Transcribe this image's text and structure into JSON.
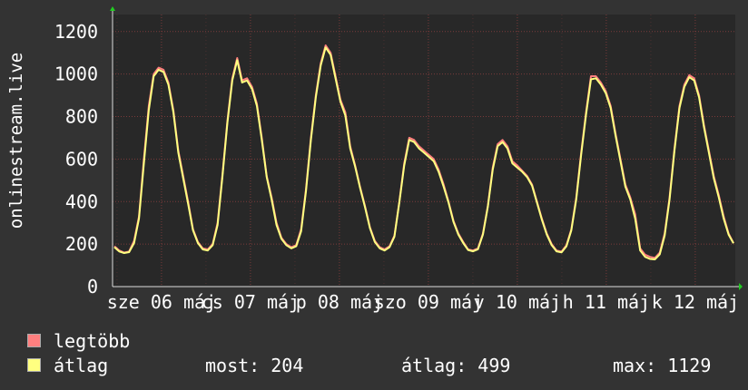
{
  "chart_data": {
    "type": "line",
    "ylabel": "onlinestream.live",
    "yticks": [
      0,
      200,
      400,
      600,
      800,
      1000,
      1200
    ],
    "ylim": [
      0,
      1280
    ],
    "x_tick_labels": [
      "sze 06 máj",
      "cs 07 máj",
      "p 08 máj",
      "szo 09 máj",
      "v 10 máj",
      "h 11 máj",
      "k 12 máj"
    ],
    "grid": true,
    "series": [
      {
        "name": "legtöbb",
        "color": "#ff7f7f",
        "values": [
          190,
          170,
          160,
          165,
          215,
          330,
          600,
          850,
          1000,
          1030,
          1020,
          960,
          830,
          640,
          520,
          400,
          270,
          210,
          180,
          175,
          200,
          300,
          530,
          780,
          980,
          1075,
          970,
          980,
          940,
          860,
          700,
          520,
          420,
          300,
          230,
          200,
          185,
          195,
          270,
          460,
          700,
          900,
          1050,
          1135,
          1100,
          990,
          880,
          820,
          660,
          570,
          470,
          380,
          280,
          215,
          185,
          175,
          190,
          240,
          400,
          580,
          700,
          690,
          660,
          640,
          620,
          600,
          550,
          480,
          400,
          310,
          250,
          210,
          175,
          170,
          180,
          250,
          380,
          560,
          670,
          690,
          660,
          590,
          570,
          545,
          520,
          480,
          400,
          320,
          250,
          200,
          170,
          165,
          195,
          270,
          420,
          630,
          820,
          990,
          990,
          960,
          920,
          850,
          720,
          600,
          480,
          420,
          340,
          180,
          150,
          140,
          135,
          160,
          250,
          420,
          650,
          850,
          950,
          995,
          980,
          900,
          760,
          640,
          520,
          430,
          330,
          250,
          205
        ]
      },
      {
        "name": "átlag",
        "color": "#ffff80",
        "values": [
          185,
          165,
          158,
          162,
          205,
          320,
          580,
          830,
          990,
          1020,
          1010,
          950,
          820,
          630,
          510,
          390,
          265,
          205,
          175,
          170,
          195,
          290,
          520,
          770,
          970,
          1065,
          960,
          970,
          930,
          850,
          690,
          515,
          410,
          290,
          225,
          195,
          180,
          190,
          260,
          450,
          690,
          890,
          1040,
          1125,
          1090,
          980,
          870,
          805,
          650,
          565,
          465,
          375,
          275,
          210,
          180,
          170,
          185,
          235,
          395,
          570,
          690,
          680,
          650,
          630,
          610,
          590,
          540,
          470,
          395,
          305,
          245,
          205,
          172,
          166,
          176,
          245,
          375,
          550,
          660,
          680,
          650,
          580,
          560,
          540,
          515,
          475,
          395,
          315,
          245,
          195,
          166,
          161,
          190,
          265,
          410,
          620,
          810,
          975,
          980,
          950,
          910,
          840,
          710,
          590,
          470,
          410,
          320,
          170,
          140,
          130,
          128,
          152,
          240,
          410,
          640,
          840,
          940,
          985,
          970,
          890,
          750,
          630,
          510,
          420,
          320,
          245,
          204
        ]
      }
    ]
  },
  "legend": [
    {
      "label": "legtöbb",
      "color": "#ff7f7f"
    },
    {
      "label": "átlag",
      "color": "#ffff80"
    }
  ],
  "stats": {
    "most": "most: 204",
    "atlag": "átlag: 499",
    "max": "max: 1129"
  }
}
